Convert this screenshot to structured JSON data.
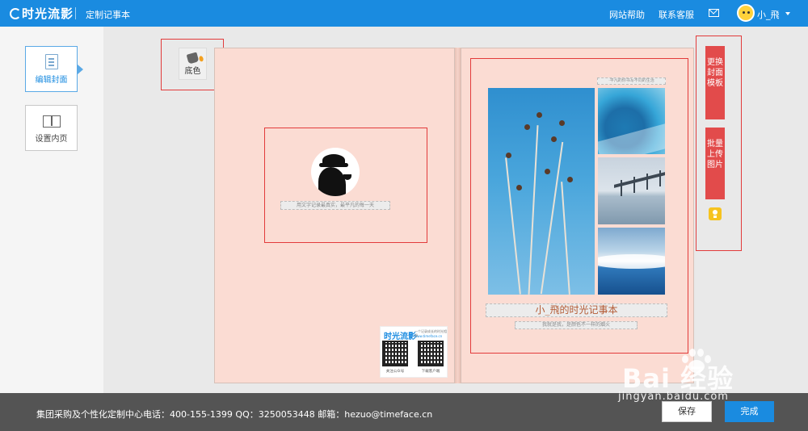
{
  "header": {
    "logo": "时光流影",
    "subtitle": "定制记事本",
    "links": [
      "网站帮助",
      "联系客服"
    ],
    "username": "小_飛"
  },
  "sidebar": {
    "items": [
      {
        "label": "编辑封面",
        "icon": "document-icon",
        "active": true
      },
      {
        "label": "设置内页",
        "icon": "book-icon",
        "active": false
      }
    ]
  },
  "toolbar": {
    "bg_color_label": "底色"
  },
  "cover_left": {
    "slogan": "用文字记录最真实，最平凡的每一天",
    "qr_card": {
      "logo": "时光流影",
      "slogan": "一个记录成长的时光相册",
      "url": "www.timeface.cn",
      "captions": [
        "关注公众号",
        "下载客户端"
      ]
    }
  },
  "cover_right": {
    "top_caption": "·平凡的你书写不同的生活",
    "title": "小_飛的时光记事本",
    "subtitle": "我就是我，是颜色不一样的烟火"
  },
  "right_actions": {
    "change_template": "更换封面模板",
    "batch_upload": "批量上传图片"
  },
  "footer": {
    "contact": "集团采购及个性化定制中心电话：400-155-1399  QQ：3250053448  邮箱：hezuo@timeface.cn",
    "save": "保存",
    "done": "完成"
  },
  "watermark": {
    "brand": "Bai 经验",
    "url": "jingyan.baidu.com"
  },
  "colors": {
    "header_blue": "#1a8be0",
    "page_pink": "#fbdcd3",
    "action_red": "#e24b4b",
    "highlight_red": "#e23b3b",
    "footer_gray": "#545454"
  }
}
